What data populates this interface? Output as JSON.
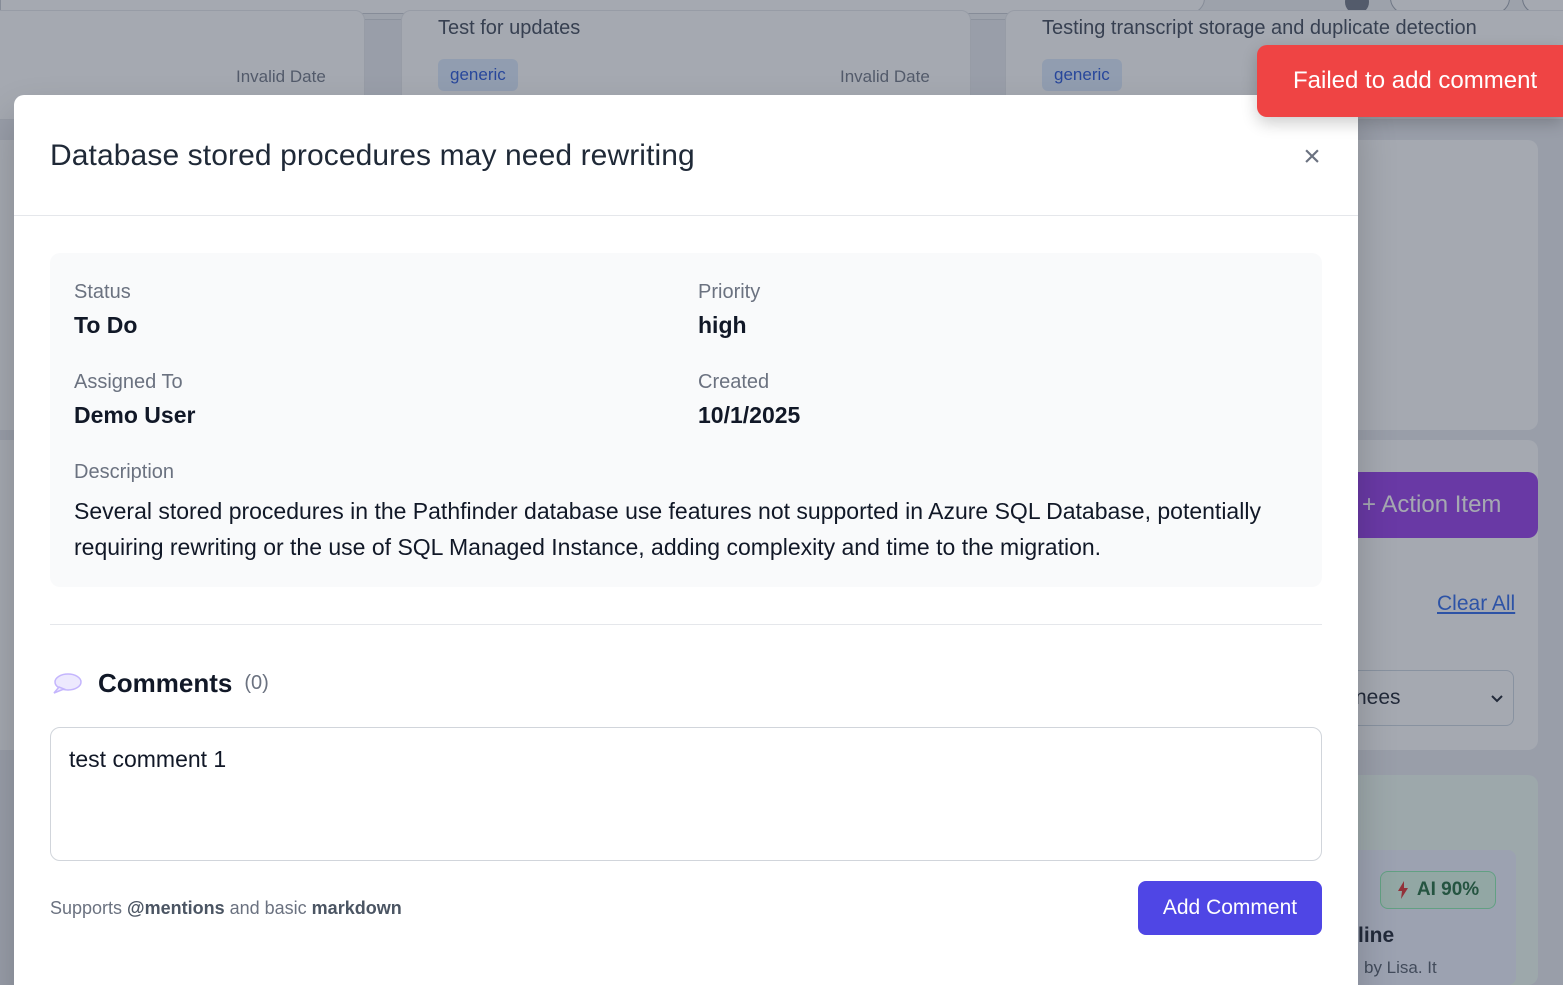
{
  "background": {
    "cards": [
      {
        "title": "",
        "date": "Invalid Date",
        "tag": ""
      },
      {
        "title": "Test for updates",
        "date": "Invalid Date",
        "tag": "generic"
      },
      {
        "title": "Testing transcript storage and duplicate detection",
        "date": "",
        "tag": "generic"
      }
    ],
    "action_item_button": "+ Action Item",
    "clear_all": "Clear All",
    "select_value": "nees",
    "ai_badge": "AI 90%",
    "card_title_fragment": "line",
    "card_sub_fragment": "by Lisa. It"
  },
  "modal": {
    "title": "Database stored procedures may need rewriting",
    "close_symbol": "×",
    "fields": {
      "status_label": "Status",
      "status_value": "To Do",
      "priority_label": "Priority",
      "priority_value": "high",
      "assigned_label": "Assigned To",
      "assigned_value": "Demo User",
      "created_label": "Created",
      "created_value": "10/1/2025",
      "description_label": "Description",
      "description_value": "Several stored procedures in the Pathfinder database use features not supported in Azure SQL Database, potentially requiring rewriting or the use of SQL Managed Instance, adding complexity and time to the migration."
    },
    "comments": {
      "title": "Comments",
      "count": "(0)",
      "input_value": "test comment 1",
      "hint_prefix": "Supports ",
      "hint_mentions": "@mentions",
      "hint_middle": " and basic ",
      "hint_markdown": "markdown",
      "add_button": "Add Comment"
    }
  },
  "toast": {
    "message": "Failed to add comment",
    "color": "#ef4444"
  }
}
